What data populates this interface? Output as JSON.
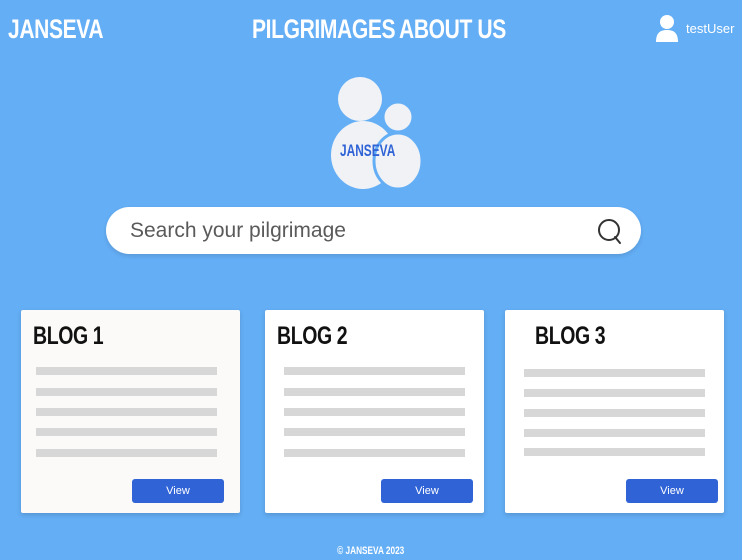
{
  "header": {
    "brand": "JANSEVA",
    "nav": [
      {
        "label": "PILGRIMAGES"
      },
      {
        "label": "ABOUT US"
      }
    ],
    "user": {
      "name": "testUser",
      "icon": "user-icon"
    }
  },
  "logo": {
    "text": "JANSEVA"
  },
  "search": {
    "placeholder": "Search your pilgrimage",
    "icon": "search-icon"
  },
  "blogs": [
    {
      "title": "BLOG 1",
      "button": "View"
    },
    {
      "title": "BLOG 2",
      "button": "View"
    },
    {
      "title": "BLOG 3",
      "button": "View"
    }
  ],
  "footer": {
    "text": "© JANSEVA 2023"
  },
  "colors": {
    "background": "#64aef5",
    "button": "#2f63d6",
    "placeholder_line": "#d7d7d7"
  }
}
